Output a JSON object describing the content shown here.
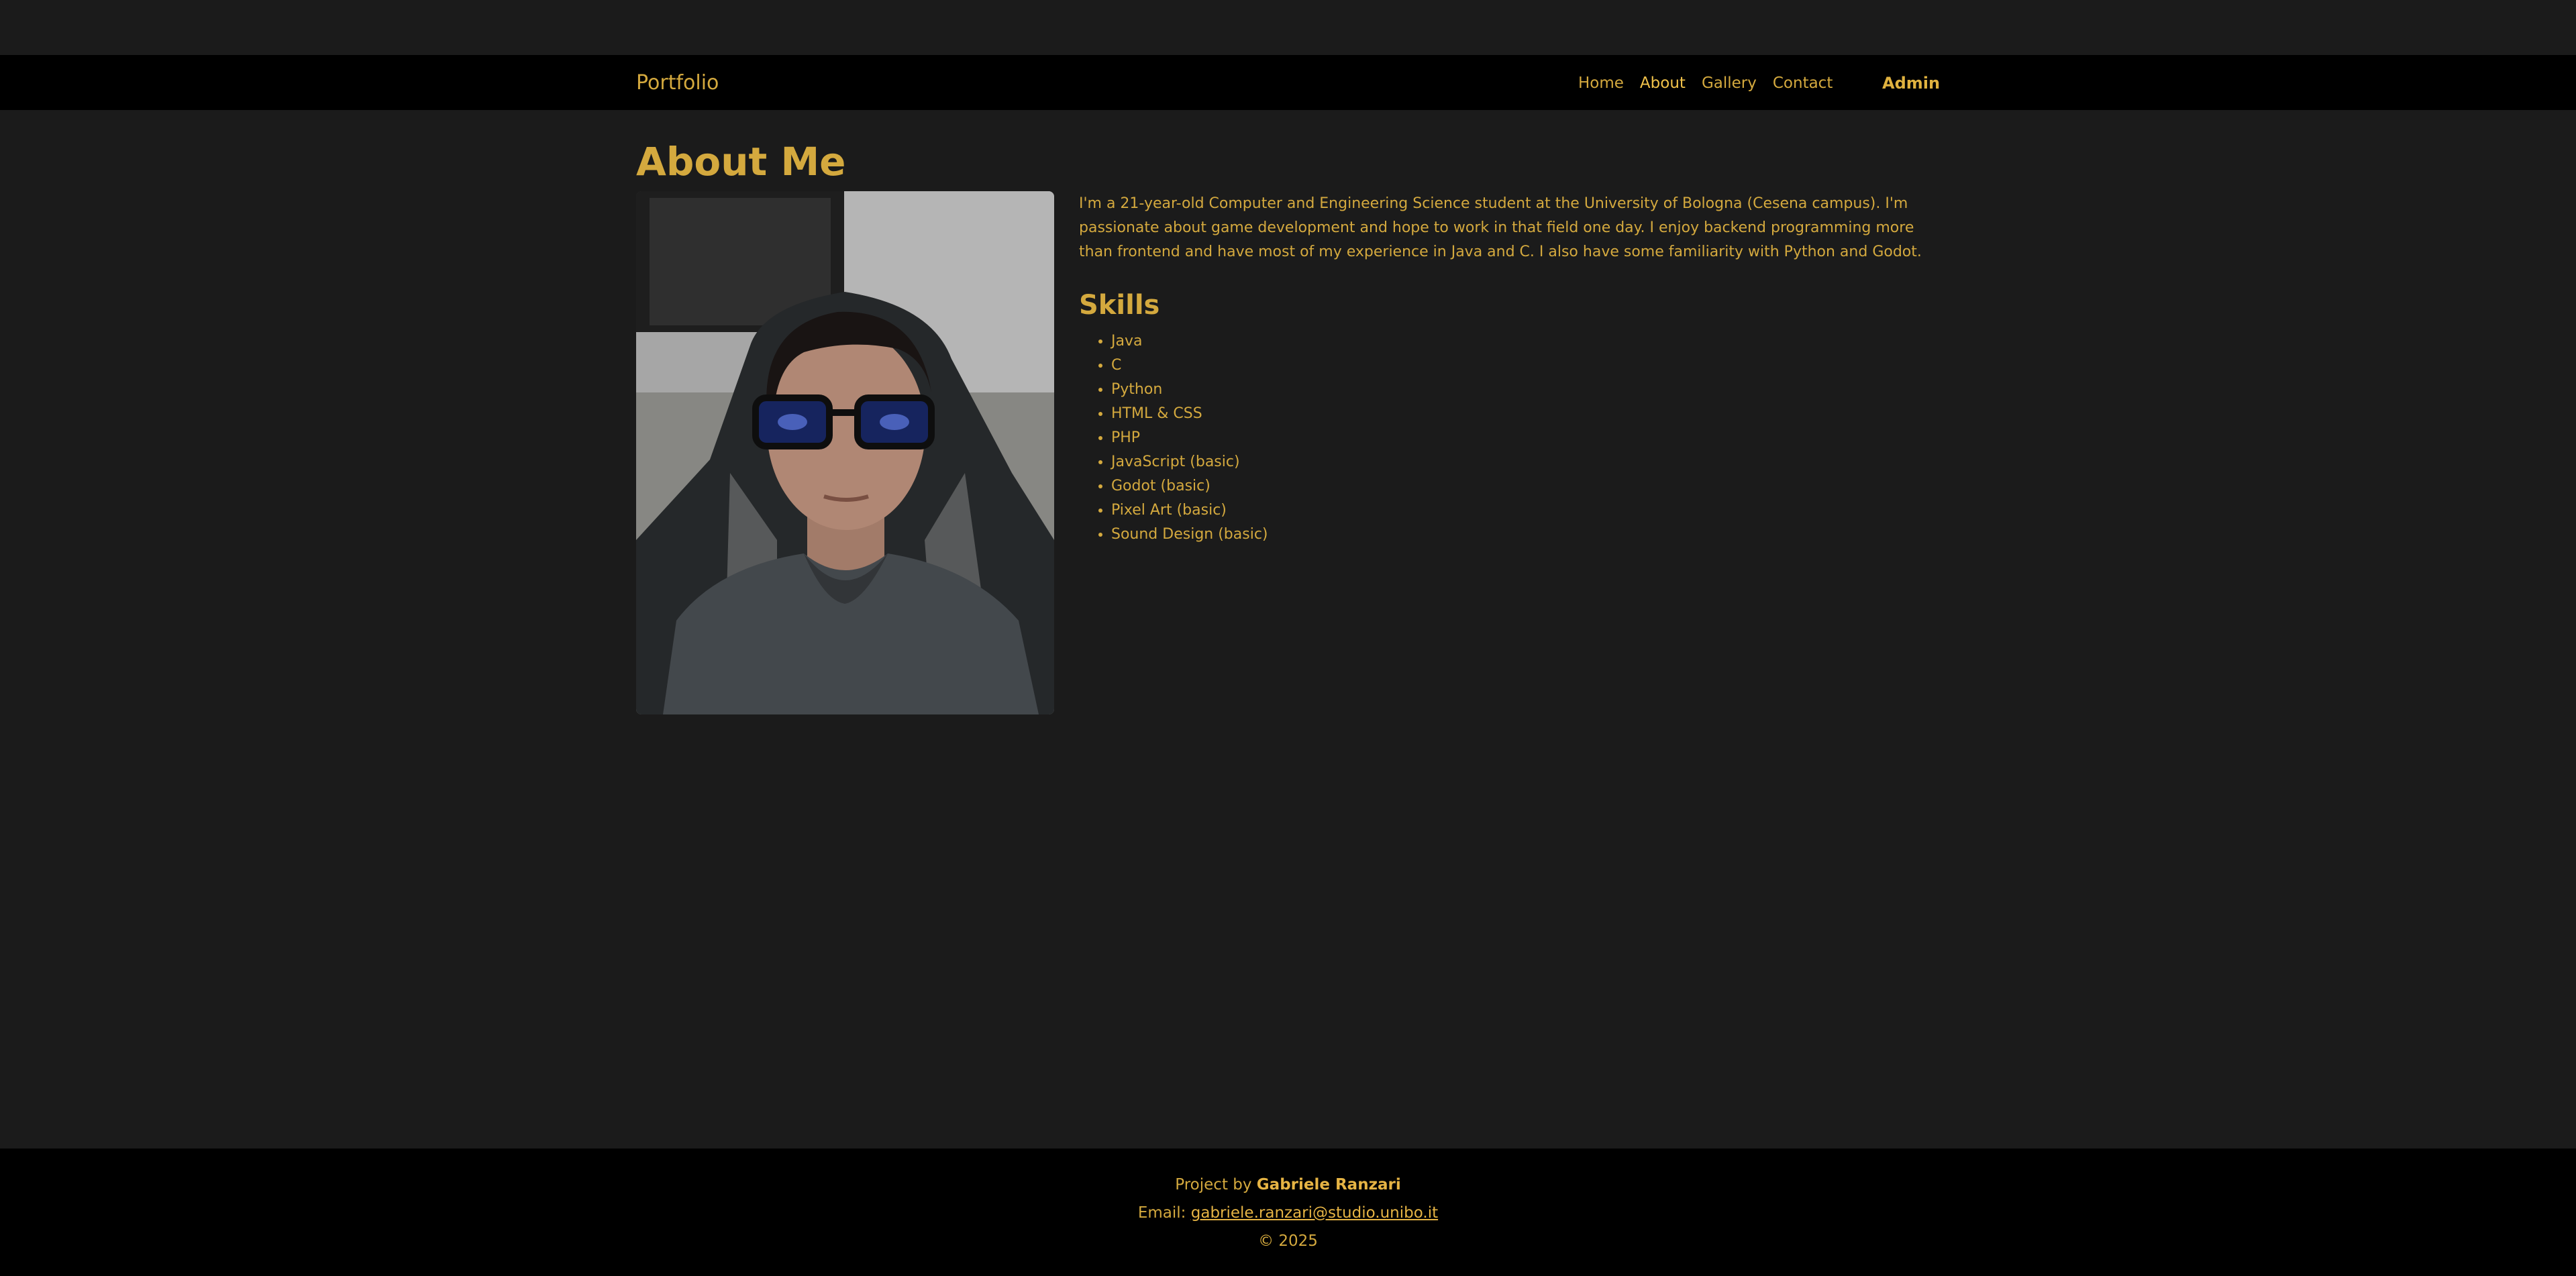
{
  "nav": {
    "brand": "Portfolio",
    "links": [
      "Home",
      "About",
      "Gallery",
      "Contact"
    ],
    "active": "About",
    "admin": "Admin"
  },
  "main": {
    "title": "About Me",
    "bio": "I'm a 21-year-old Computer and Engineering Science student at the University of Bologna (Cesena campus). I'm passionate about game development and hope to work in that field one day. I enjoy backend programming more than frontend and have most of my experience in Java and C. I also have some familiarity with Python and Godot.",
    "skills_title": "Skills",
    "skills": [
      "Java",
      "C",
      "Python",
      "HTML & CSS",
      "PHP",
      "JavaScript (basic)",
      "Godot (basic)",
      "Pixel Art (basic)",
      "Sound Design (basic)"
    ]
  },
  "footer": {
    "project_prefix": "Project by ",
    "author": "Gabriele Ranzari",
    "email_prefix": "Email: ",
    "email": "gabriele.ranzari@studio.unibo.it",
    "copyright": "© 2025"
  },
  "colors": {
    "accent": "#d4a93e",
    "background": "#1b1b1b",
    "bars": "#000000"
  }
}
